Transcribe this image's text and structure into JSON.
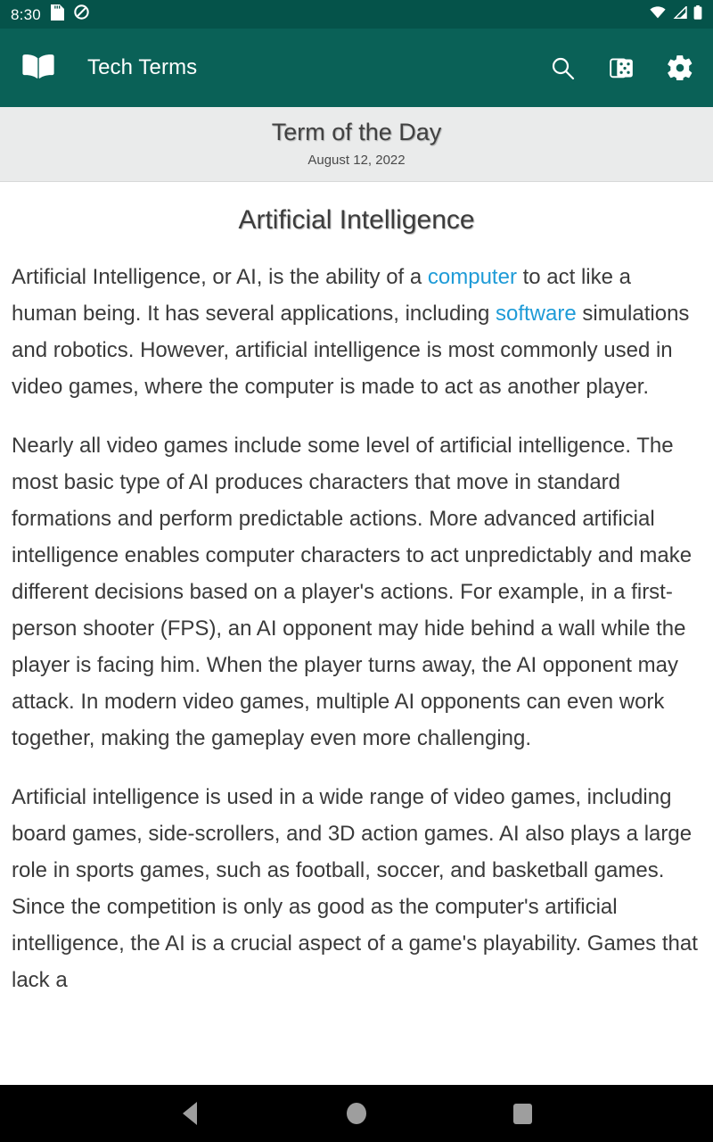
{
  "status_bar": {
    "time": "8:30",
    "icons": [
      "sd-card-icon",
      "do-not-disturb-icon"
    ],
    "right_icons": [
      "wifi-icon",
      "cellular-signal-icon",
      "battery-icon"
    ],
    "background_color": "#05534A"
  },
  "app_bar": {
    "logo_icon": "open-book-icon",
    "title": "Tech Terms",
    "background_color": "#0A6157",
    "actions": [
      {
        "name": "search",
        "icon": "search-icon"
      },
      {
        "name": "random",
        "icon": "dice-icon"
      },
      {
        "name": "settings",
        "icon": "gear-icon"
      }
    ]
  },
  "term_of_the_day": {
    "heading": "Term of the Day",
    "date": "August 12, 2022",
    "background_color": "#EAEBEB"
  },
  "article": {
    "title": "Artificial Intelligence",
    "link_color": "#1E9BD7",
    "paragraphs": [
      {
        "parts": [
          {
            "type": "text",
            "value": "Artificial Intelligence, or AI, is the ability of a "
          },
          {
            "type": "link",
            "value": "computer"
          },
          {
            "type": "text",
            "value": " to act like a human being. It has several applications, including "
          },
          {
            "type": "link",
            "value": "software"
          },
          {
            "type": "text",
            "value": " simulations and robotics. However, artificial intelligence is most commonly used in video games, where the computer is made to act as another player."
          }
        ]
      },
      {
        "parts": [
          {
            "type": "text",
            "value": "Nearly all video games include some level of artificial intelligence. The most basic type of AI produces characters that move in standard formations and perform predictable actions. More advanced artificial intelligence enables computer characters to act unpredictably and make different decisions based on a player's actions. For example, in a first-person shooter (FPS), an AI opponent may hide behind a wall while the player is facing him. When the player turns away, the AI opponent may attack. In modern video games, multiple AI opponents can even work together, making the gameplay even more challenging."
          }
        ]
      },
      {
        "parts": [
          {
            "type": "text",
            "value": "Artificial intelligence is used in a wide range of video games, including board games, side-scrollers, and 3D action games. AI also plays a large role in sports games, such as football, soccer, and basketball games. Since the competition is only as good as the computer's artificial intelligence, the AI is a crucial aspect of a game's playability. Games that lack a"
          }
        ]
      }
    ]
  },
  "nav_bar": {
    "buttons": [
      {
        "name": "back",
        "icon": "back-triangle-icon"
      },
      {
        "name": "home",
        "icon": "home-circle-icon"
      },
      {
        "name": "recents",
        "icon": "recents-square-icon"
      }
    ],
    "background_color": "#000000"
  }
}
